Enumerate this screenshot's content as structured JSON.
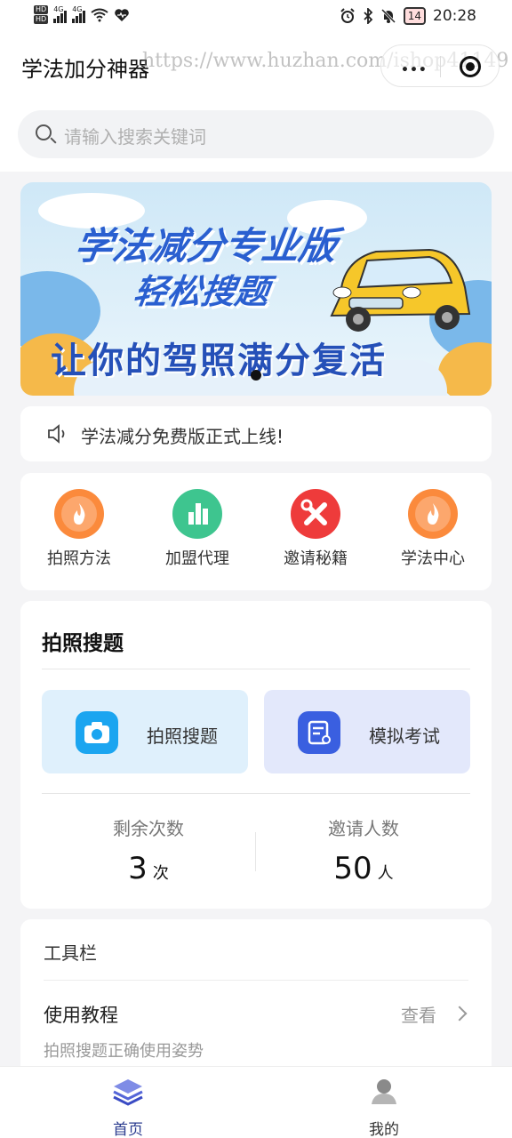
{
  "status_bar": {
    "network_left": "4G",
    "network_right": "4G",
    "hd": "HD",
    "battery": "14",
    "time": "20:28"
  },
  "header": {
    "app_title": "学法加分神器",
    "watermark": "https://www.huzhan.com/ishop41149",
    "more_glyph": "•••"
  },
  "search": {
    "placeholder": "请输入搜索关键词"
  },
  "banner": {
    "line1": "学法减分专业版",
    "line2": "轻松搜题",
    "line3": "让你的驾照满分复活"
  },
  "notice": {
    "text": "学法减分免费版正式上线!"
  },
  "quick_menu": [
    {
      "label": "拍照方法",
      "icon": "flame-icon",
      "color": "#fb8a3c"
    },
    {
      "label": "加盟代理",
      "icon": "bar-chart-icon",
      "color": "#3ec58f"
    },
    {
      "label": "邀请秘籍",
      "icon": "tools-icon",
      "color": "#ee3b3b"
    },
    {
      "label": "学法中心",
      "icon": "flame-icon",
      "color": "#fb8a3c"
    }
  ],
  "photo_section": {
    "title": "拍照搜题",
    "cards": [
      {
        "label": "拍照搜题",
        "icon": "camera-icon",
        "bg": "#dff0fc",
        "icon_color": "#1ba5f0"
      },
      {
        "label": "模拟考试",
        "icon": "exam-icon",
        "bg": "#e3e8fb",
        "icon_color": "#3a5fe0"
      }
    ],
    "stats": [
      {
        "label": "剩余次数",
        "value": "3",
        "unit": "次"
      },
      {
        "label": "邀请人数",
        "value": "50",
        "unit": "人"
      }
    ]
  },
  "tools": {
    "title": "工具栏",
    "item_title": "使用教程",
    "item_action": "查看",
    "item_desc": "拍照搜题正确使用姿势"
  },
  "tabbar": [
    {
      "label": "首页",
      "icon": "home-layers-icon",
      "active": true,
      "color": "#2a3b8f"
    },
    {
      "label": "我的",
      "icon": "user-icon",
      "active": false,
      "color": "#333333"
    }
  ]
}
